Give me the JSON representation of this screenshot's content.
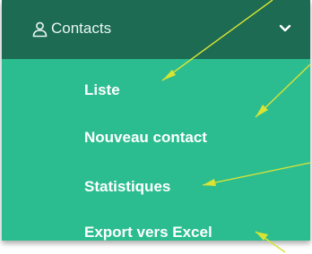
{
  "sidebar": {
    "section": {
      "label": "Contacts",
      "icon": "user-icon",
      "toggle_icon": "chevron-down-icon"
    },
    "items": [
      {
        "label": "Liste"
      },
      {
        "label": "Nouveau contact"
      },
      {
        "label": "Statistiques"
      },
      {
        "label": "Export vers Excel"
      }
    ]
  },
  "colors": {
    "header_bg": "#1d6b53",
    "menu_bg": "#2bbd90",
    "item_text": "#ffffff",
    "annotation_arrow": "#d9e334"
  }
}
